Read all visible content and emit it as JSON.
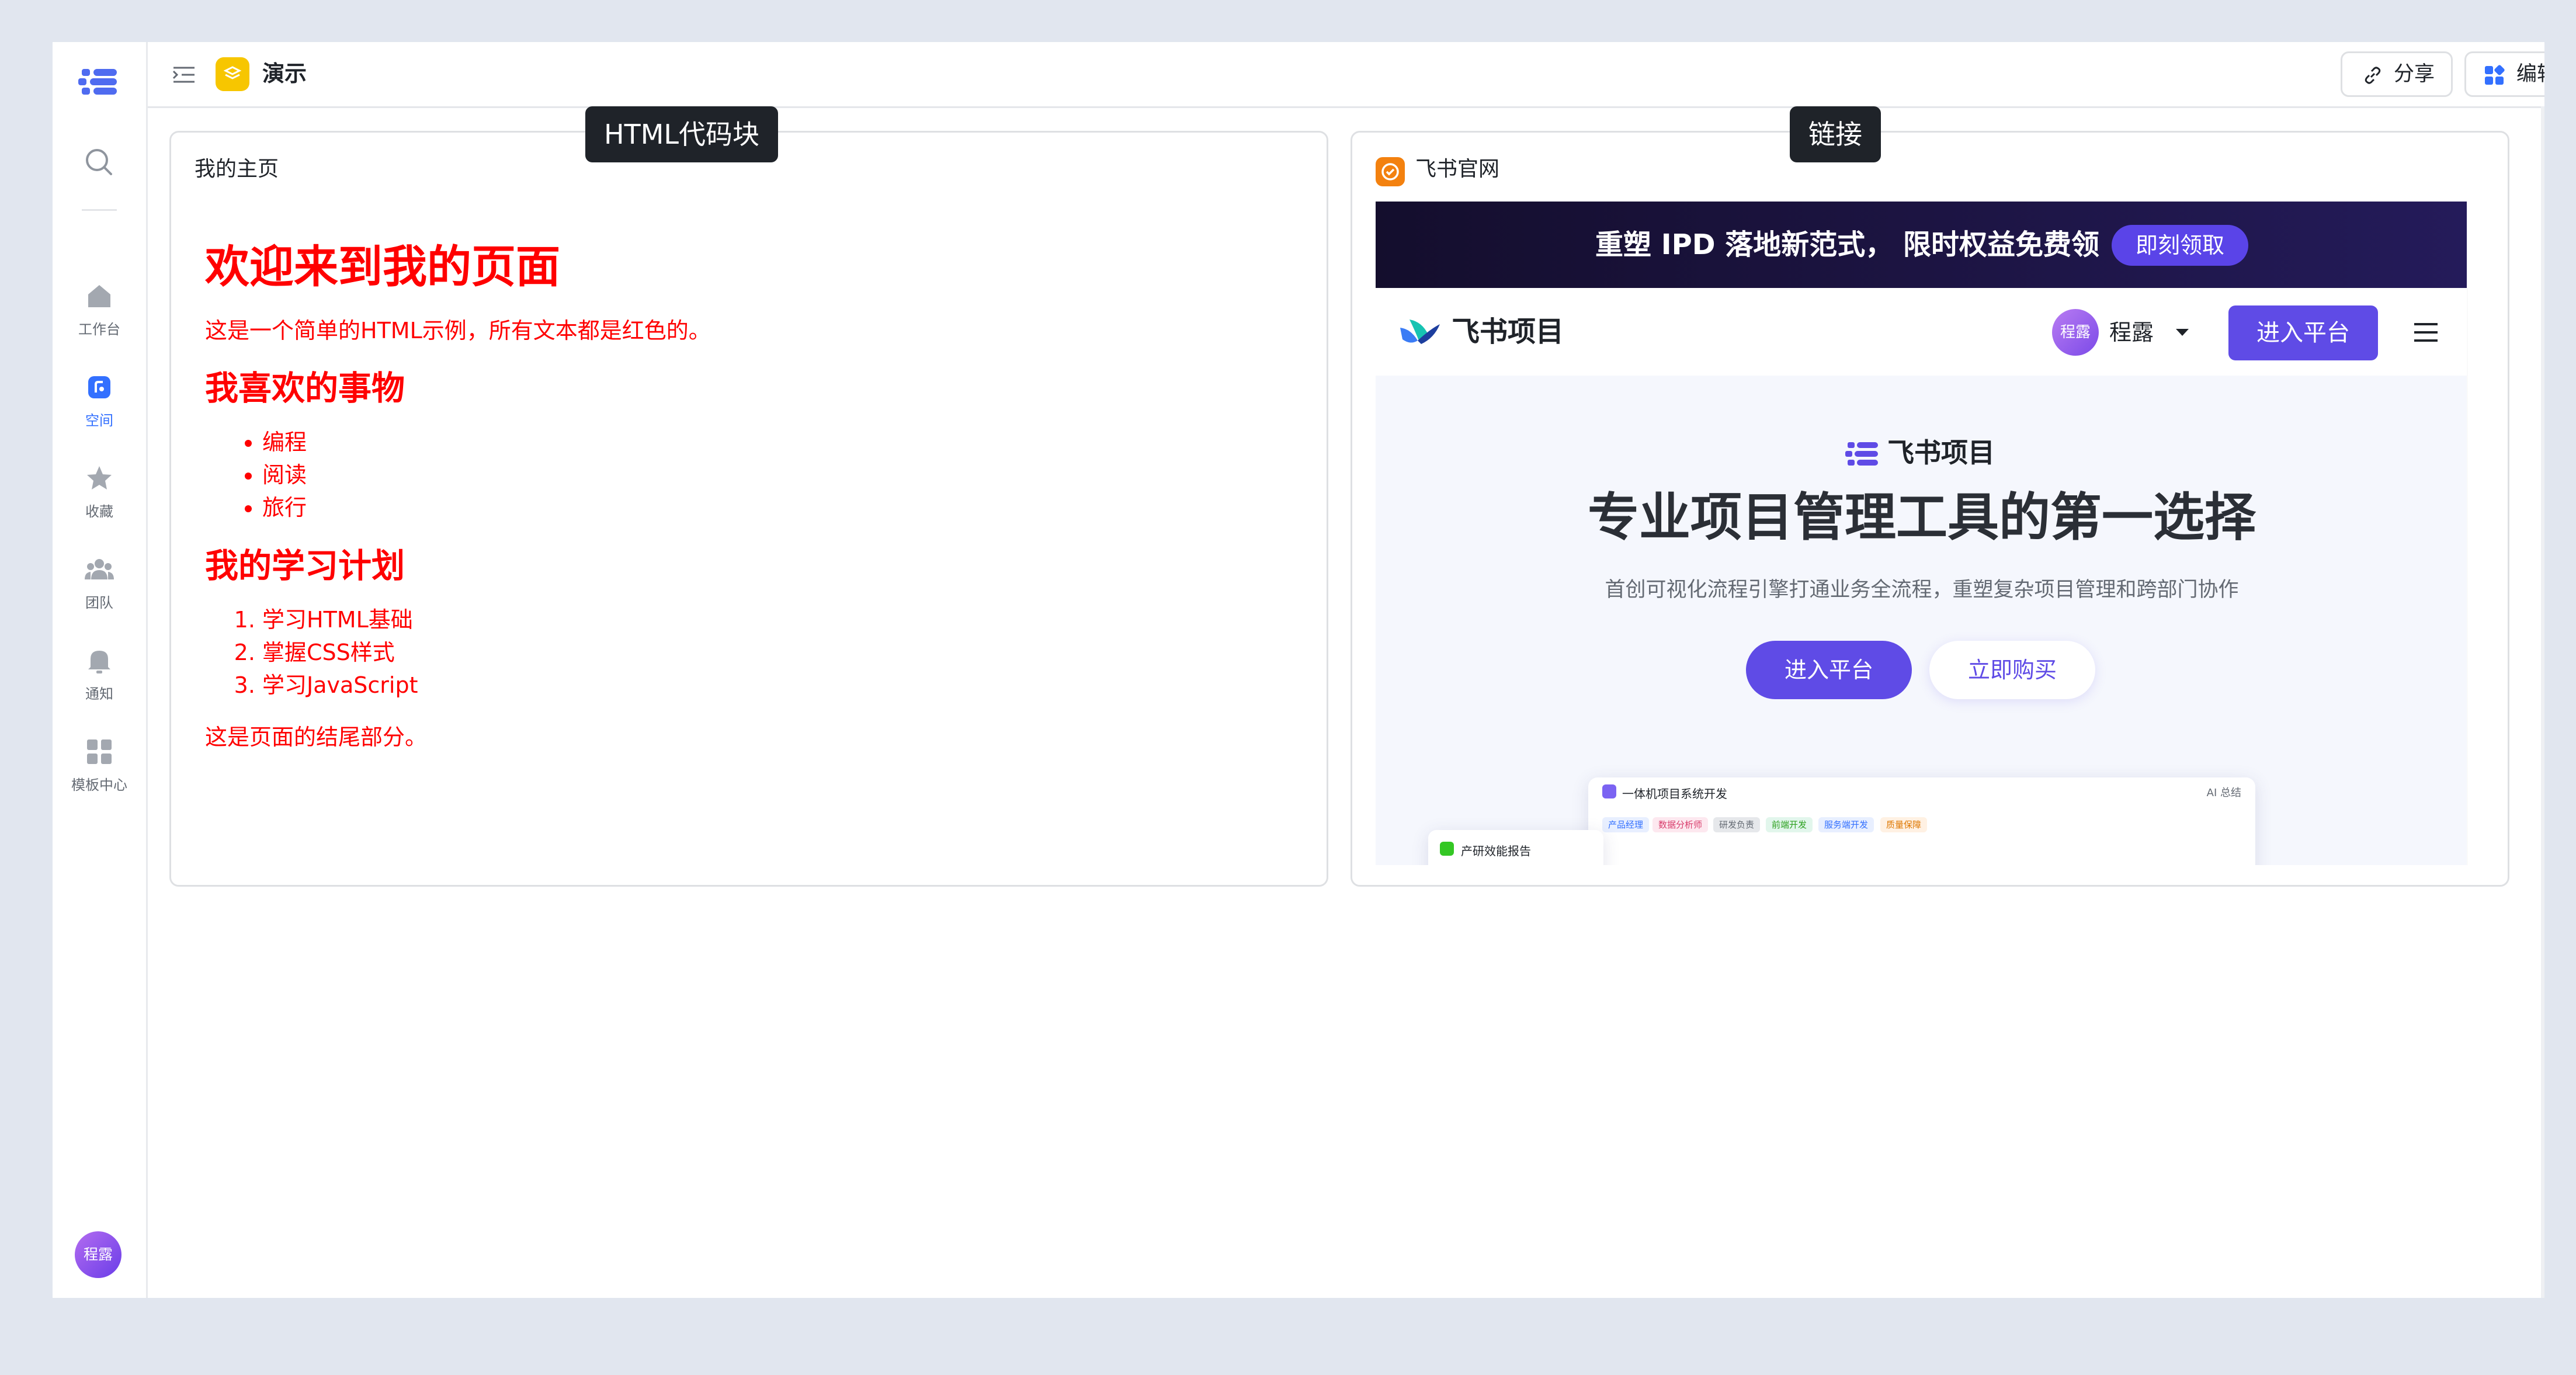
{
  "rail": {
    "items": [
      {
        "label": "工作台",
        "icon": "home-icon"
      },
      {
        "label": "空间",
        "icon": "space-icon",
        "active": true
      },
      {
        "label": "收藏",
        "icon": "star-icon"
      },
      {
        "label": "团队",
        "icon": "team-icon"
      },
      {
        "label": "通知",
        "icon": "bell-icon"
      },
      {
        "label": "模板中心",
        "icon": "template-icon"
      }
    ],
    "avatar": "程露"
  },
  "topbar": {
    "title": "演示",
    "share_label": "分享",
    "edit_label": "编辑"
  },
  "tooltips": {
    "html_block": "HTML代码块",
    "link": "链接"
  },
  "html_block": {
    "title": "我的主页",
    "h1": "欢迎来到我的页面",
    "intro": "这是一个简单的HTML示例，所有文本都是红色的。",
    "h2_likes": "我喜欢的事物",
    "likes": [
      "编程",
      "阅读",
      "旅行"
    ],
    "h2_plan": "我的学习计划",
    "plan": [
      "学习HTML基础",
      "掌握CSS样式",
      "学习JavaScript"
    ],
    "footer": "这是页面的结尾部分。"
  },
  "link_block": {
    "title": "飞书官网",
    "banner_text": "重塑 IPD 落地新范式， 限时权益免费领",
    "banner_button": "即刻领取",
    "brand": "飞书项目",
    "user_avatar": "程露",
    "user_name": "程露",
    "nav_enter": "进入平台",
    "hero_logo": "飞书项目",
    "hero_title": "专业项目管理工具的第一选择",
    "hero_subtitle": "首创可视化流程引擎打通业务全流程，重塑复杂项目管理和跨部门协作",
    "hero_primary": "进入平台",
    "hero_secondary": "立即购买",
    "card_title": "一体机项目系统开发",
    "card_ai": "AI 总结",
    "card_tags": [
      "产品经理",
      "数据分析师",
      "研发负责",
      "前端开发",
      "服务端开发",
      "质量保障"
    ],
    "card2_title": "产研效能报告"
  },
  "colors": {
    "accent": "#3370ff",
    "html_text": "#ff0000",
    "feishu_purple": "#5f4be6",
    "app_icon": "#f7c600"
  }
}
